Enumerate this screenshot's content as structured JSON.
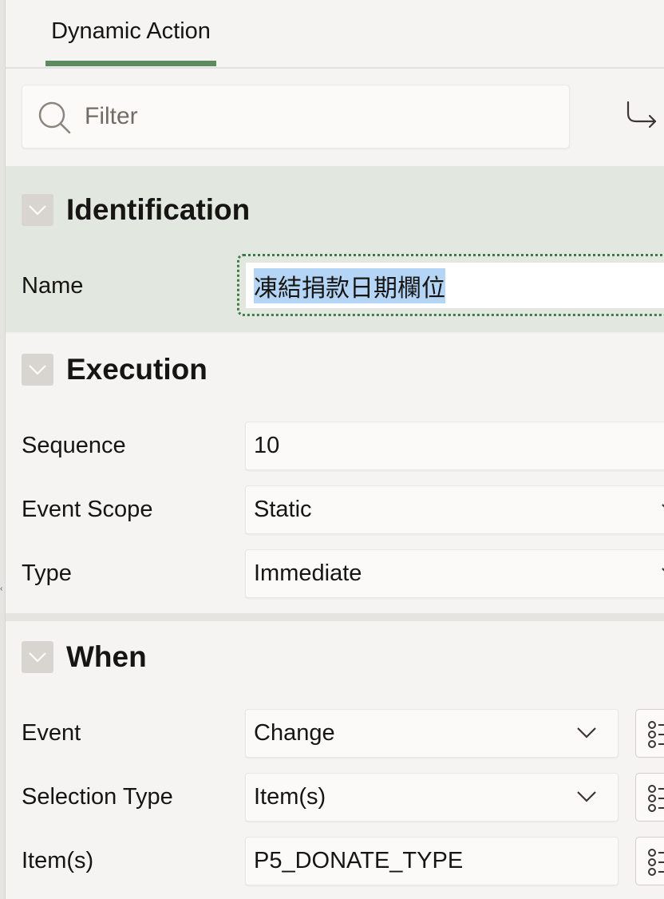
{
  "tab": {
    "label": "Dynamic Action"
  },
  "toolbar": {
    "filter_placeholder": "Filter"
  },
  "sections": {
    "identification": {
      "title": "Identification",
      "name_label": "Name",
      "name_value": "凍結捐款日期欄位"
    },
    "execution": {
      "title": "Execution",
      "sequence_label": "Sequence",
      "sequence_value": "10",
      "event_scope_label": "Event Scope",
      "event_scope_value": "Static",
      "type_label": "Type",
      "type_value": "Immediate"
    },
    "when": {
      "title": "When",
      "event_label": "Event",
      "event_value": "Change",
      "selection_type_label": "Selection Type",
      "selection_type_value": "Item(s)",
      "items_label": "Item(s)",
      "items_value": "P5_DONATE_TYPE"
    }
  },
  "colors": {
    "tab_underline": "#5b8b5f",
    "identification_bg": "#e2e7df",
    "selection_highlight": "#b4d5f5",
    "focus_ring": "#3f7a4b"
  },
  "icons": [
    "search-icon",
    "go-to-arrow-icon",
    "chevron-down-icon",
    "list-of-values-icon"
  ]
}
